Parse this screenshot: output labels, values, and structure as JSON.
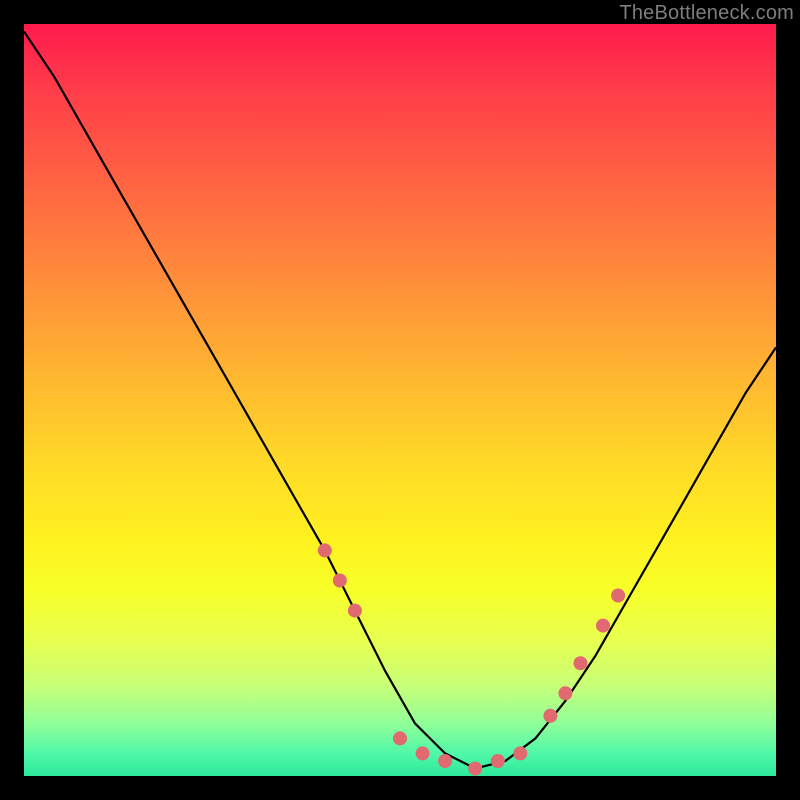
{
  "watermark": "TheBottleneck.com",
  "chart_data": {
    "type": "line",
    "title": "",
    "xlabel": "",
    "ylabel": "",
    "xlim": [
      0,
      100
    ],
    "ylim": [
      0,
      100
    ],
    "gradient_background": {
      "top": "#ff1a4d",
      "middle": "#ffd828",
      "bottom": "#2de89c"
    },
    "series": [
      {
        "name": "curve",
        "color": "#000000",
        "x": [
          0,
          4,
          8,
          12,
          16,
          20,
          24,
          28,
          32,
          36,
          40,
          44,
          48,
          52,
          56,
          60,
          64,
          68,
          72,
          76,
          80,
          84,
          88,
          92,
          96,
          100
        ],
        "values": [
          99,
          93,
          86,
          79,
          72,
          65,
          58,
          51,
          44,
          37,
          30,
          22,
          14,
          7,
          3,
          1,
          2,
          5,
          10,
          16,
          23,
          30,
          37,
          44,
          51,
          57
        ]
      },
      {
        "name": "markers",
        "color": "#e06a6f",
        "type": "scatter",
        "x": [
          40,
          42,
          44,
          50,
          53,
          56,
          60,
          63,
          66,
          70,
          72,
          74,
          77,
          79
        ],
        "values": [
          30,
          26,
          22,
          5,
          3,
          2,
          1,
          2,
          3,
          8,
          11,
          15,
          20,
          24
        ]
      }
    ]
  }
}
